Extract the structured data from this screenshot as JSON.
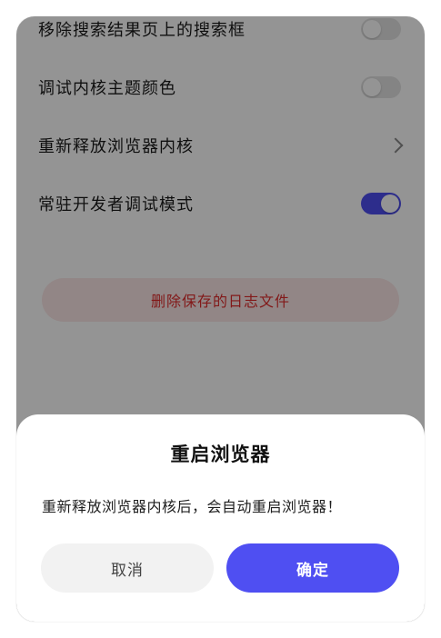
{
  "settings": {
    "rows": [
      {
        "label": "移除搜索结果页上的搜索框",
        "control": "toggle",
        "state": "off"
      },
      {
        "label": "调试内核主题颜色",
        "control": "toggle",
        "state": "off"
      },
      {
        "label": "重新释放浏览器内核",
        "control": "chevron"
      },
      {
        "label": "常驻开发者调试模式",
        "control": "toggle",
        "state": "on"
      }
    ],
    "delete_logs_label": "删除保存的日志文件"
  },
  "dialog": {
    "title": "重启浏览器",
    "message": "重新释放浏览器内核后，会自动重启浏览器！",
    "cancel_label": "取消",
    "confirm_label": "确定"
  },
  "colors": {
    "accent": "#4f4ff2",
    "danger": "#e02b2b",
    "danger_bg": "#fbe7e7",
    "overlay": "rgba(0,0,0,0.42)"
  }
}
